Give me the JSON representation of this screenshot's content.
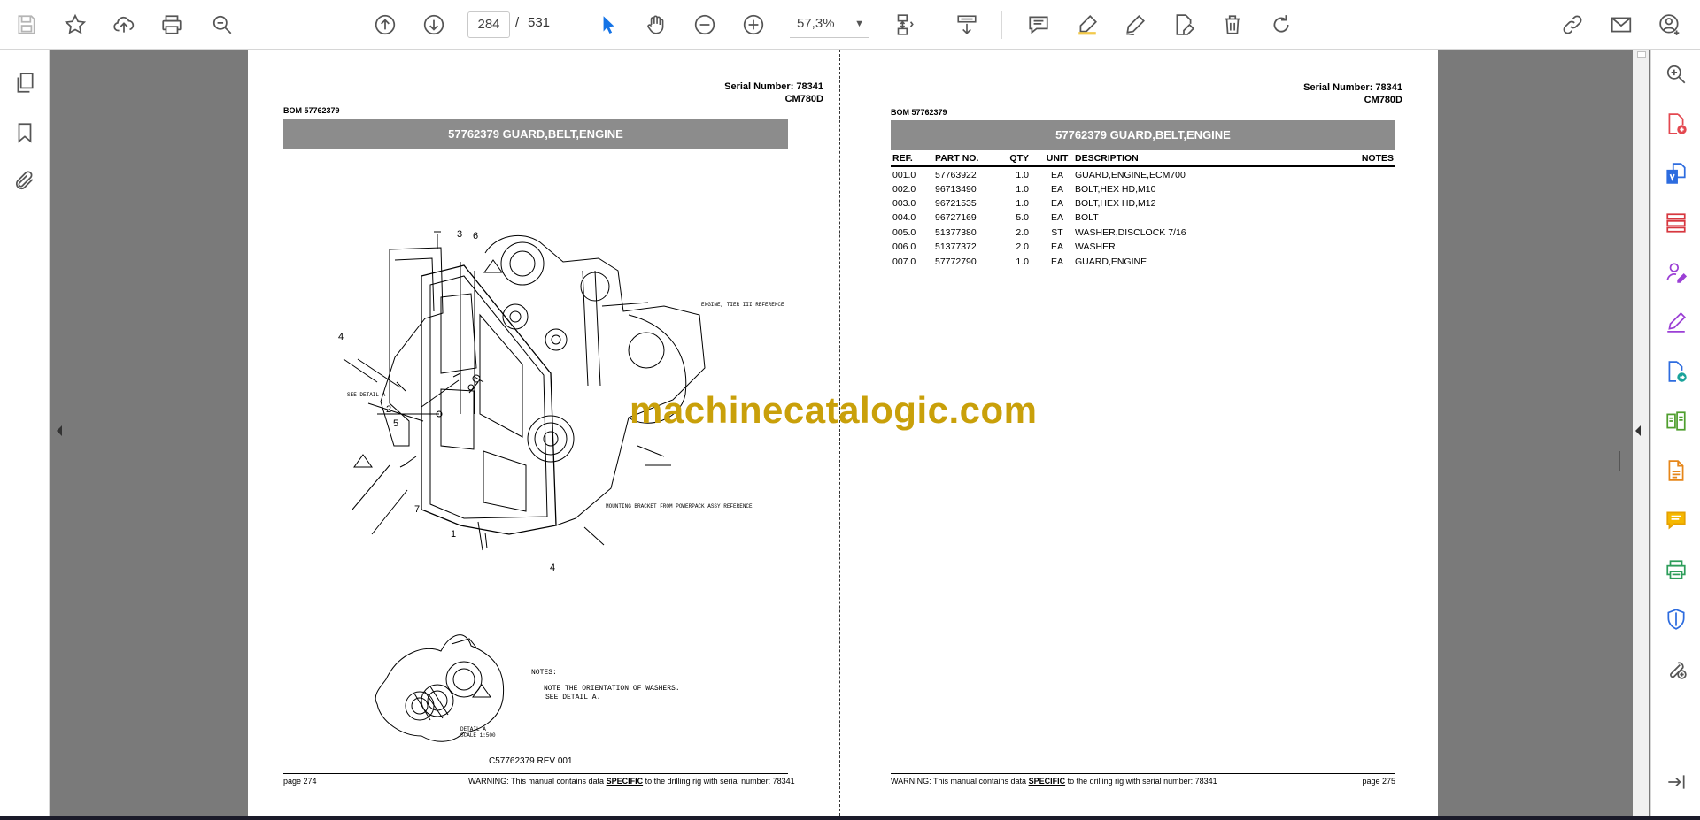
{
  "toolbar": {
    "current_page": "284",
    "page_separator": "/",
    "total_pages": "531",
    "zoom": "57,3%"
  },
  "left_page": {
    "serial": "Serial Number: 78341",
    "model": "CM780D",
    "bom": "BOM 57762379",
    "title": "57762379 GUARD,BELT,ENGINE",
    "drawing": {
      "callouts": [
        "3",
        "6",
        "4",
        "2",
        "5",
        "7",
        "1",
        "4"
      ],
      "engine_note": "ENGINE, TIER III REFERENCE",
      "see_detail": "SEE DETAIL A",
      "bracket_note": "MOUNTING BRACKET FROM POWERPACK ASSY REFERENCE",
      "notes_heading": "NOTES:",
      "note_1": "NOTE THE ORIENTATION OF WASHERS.",
      "note_2": "SEE DETAIL A.",
      "detail_label": "DETAIL A",
      "detail_scale": "SCALE 1:500"
    },
    "drawing_number": "C57762379 REV 001",
    "footer_page": "page 274",
    "footer_warning_pre": "WARNING:  This manual contains data ",
    "footer_warning_em": "SPECIFIC",
    "footer_warning_post": " to the drilling rig with serial number: 78341"
  },
  "right_page": {
    "serial": "Serial Number: 78341",
    "model": "CM780D",
    "bom": "BOM 57762379",
    "title": "57762379 GUARD,BELT,ENGINE",
    "table": {
      "headers": [
        "REF.",
        "PART NO.",
        "QTY",
        "UNIT",
        "DESCRIPTION",
        "NOTES"
      ],
      "rows": [
        [
          "001.0",
          "57763922",
          "1.0",
          "EA",
          "GUARD,ENGINE,ECM700",
          ""
        ],
        [
          "002.0",
          "96713490",
          "1.0",
          "EA",
          "BOLT,HEX HD,M10",
          ""
        ],
        [
          "003.0",
          "96721535",
          "1.0",
          "EA",
          "BOLT,HEX HD,M12",
          ""
        ],
        [
          "004.0",
          "96727169",
          "5.0",
          "EA",
          "BOLT",
          ""
        ],
        [
          "005.0",
          "51377380",
          "2.0",
          "ST",
          "WASHER,DISCLOCK 7/16",
          ""
        ],
        [
          "006.0",
          "51377372",
          "2.0",
          "EA",
          "WASHER",
          ""
        ],
        [
          "007.0",
          "57772790",
          "1.0",
          "EA",
          "GUARD,ENGINE",
          ""
        ]
      ]
    },
    "footer_warning_pre": "WARNING:  This manual contains data ",
    "footer_warning_em": "SPECIFIC",
    "footer_warning_post": " to the drilling rig with serial number: 78341",
    "footer_page": "page 275"
  },
  "watermark": "machinecatalogic.com",
  "colors": {
    "accent_blue": "#1473e6",
    "title_bar": "#8c8c8c",
    "watermark": "#c9a00a"
  },
  "icons": {
    "toolbar": [
      "save-icon",
      "bookmark-star-icon",
      "cloud-upload-icon",
      "print-icon",
      "zoom-search-icon",
      "page-up-icon",
      "page-down-icon",
      "select-cursor-icon",
      "hand-tool-icon",
      "zoom-out-icon",
      "zoom-in-icon",
      "page-fit-icon",
      "scroll-mode-icon",
      "comment-icon",
      "highlight-icon",
      "draw-icon",
      "fill-sign-icon",
      "delete-icon",
      "rotate-icon",
      "share-link-icon",
      "email-icon",
      "account-icon"
    ],
    "left_rail": [
      "page-thumbnails-icon",
      "bookmarks-icon",
      "attachments-icon"
    ],
    "right_rail": [
      "zoom-tool-icon",
      "create-pdf-icon",
      "export-pdf-icon",
      "organize-pages-icon",
      "request-signature-icon",
      "fill-and-sign-icon",
      "send-for-review-icon",
      "compare-files-icon",
      "edit-pdf-icon",
      "comment-tool-icon",
      "print-production-icon",
      "protect-icon",
      "more-tools-icon",
      "expand-panel-icon"
    ]
  }
}
